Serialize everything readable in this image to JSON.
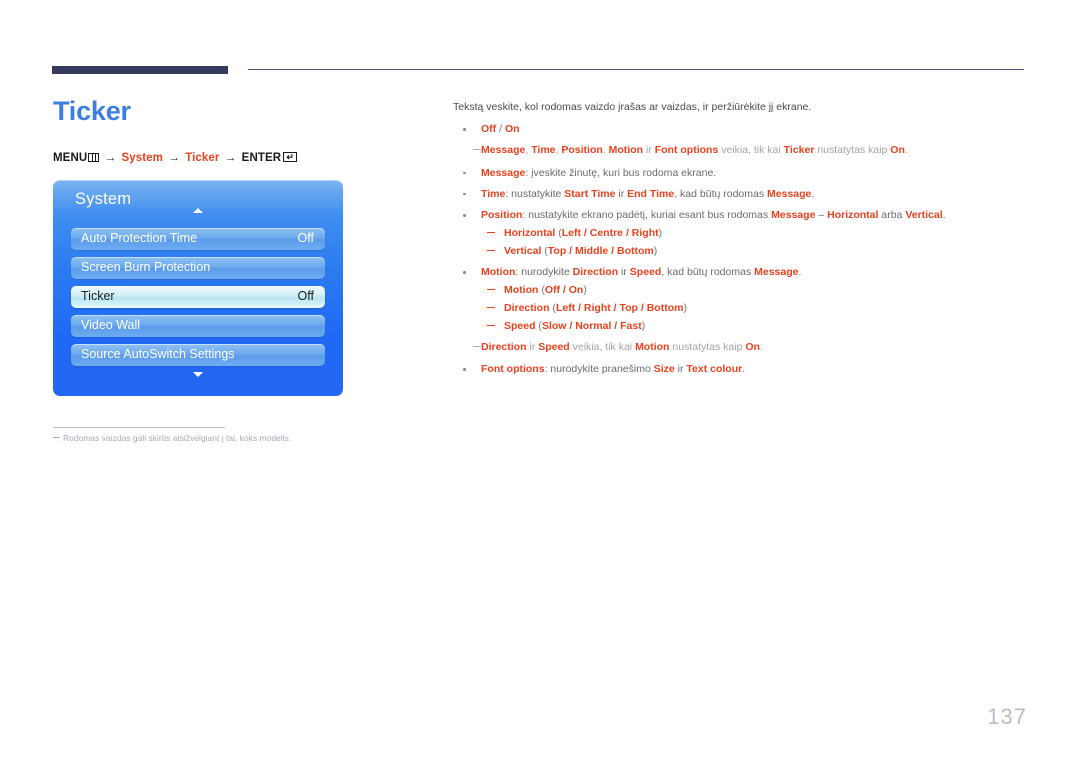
{
  "header": {
    "title": "Ticker",
    "breadcrumb": {
      "menu_label": "MENU",
      "menu_icon": "menu-bars-icon",
      "arrow": "→",
      "step1": "System",
      "step2": "Ticker",
      "enter_label": "ENTER",
      "enter_icon": "enter-key-icon",
      "enter_glyph": "↵"
    }
  },
  "osd": {
    "title": "System",
    "scroll_up_icon": "caret-up-icon",
    "scroll_down_icon": "caret-down-icon",
    "rows": [
      {
        "label": "Auto Protection Time",
        "value": "Off",
        "selected": false
      },
      {
        "label": "Screen Burn Protection",
        "value": "",
        "selected": false
      },
      {
        "label": "Ticker",
        "value": "Off",
        "selected": true
      },
      {
        "label": "Video Wall",
        "value": "",
        "selected": false
      },
      {
        "label": "Source AutoSwitch Settings",
        "value": "",
        "selected": false
      }
    ]
  },
  "footnote": {
    "text": "Rodomas vaizdas gali skirtis atsižvelgiant į tai, koks modelis."
  },
  "content": {
    "intro": "Tekstą veskite, kol rodomas vaizdo įrašas ar vaizdas, ir peržiūrėkite jį ekrane.",
    "b1": {
      "off": "Off",
      "slash": " / ",
      "on": "On"
    },
    "note1": {
      "t1": "Message",
      "c1": ", ",
      "t2": "Time",
      "c2": ", ",
      "t3": "Position",
      "c3": ", ",
      "t4": "Motion",
      "c4": " ir ",
      "t5": "Font options",
      "tail1": " veikia, tik kai ",
      "t6": "Ticker",
      "tail2": " nustatytas kaip ",
      "t7": "On",
      "tail3": "."
    },
    "b2": {
      "term": "Message",
      "rest": ": įveskite žinutę, kuri bus rodoma ekrane."
    },
    "b3": {
      "term": "Time",
      "p1": ": nustatykite ",
      "t1": "Start Time",
      "p2": " ir ",
      "t2": "End Time",
      "p3": ", kad būtų rodomas ",
      "t3": "Message",
      "p4": "."
    },
    "b4": {
      "term": "Position",
      "p1": ": nustatykite ekrano padėtį, kuriai esant bus rodomas ",
      "t1": "Message",
      "p2": " – ",
      "t2": "Horizontal",
      "p3": " arba ",
      "t3": "Vertical",
      "p4": "."
    },
    "b4_sub": [
      {
        "term": "Horizontal",
        "open": " (",
        "opts": "Left / Centre / Right",
        "close": ")"
      },
      {
        "term": "Vertical",
        "open": " (",
        "opts": "Top / Middle / Bottom",
        "close": ")"
      }
    ],
    "b5": {
      "term": "Motion",
      "p1": ": nurodykite ",
      "t1": "Direction",
      "p2": " ir ",
      "t2": "Speed",
      "p3": ", kad būtų rodomas ",
      "t3": "Message",
      "p4": "."
    },
    "b5_sub": [
      {
        "term": "Motion",
        "open": " (",
        "opts": "Off / On",
        "close": ")"
      },
      {
        "term": "Direction",
        "open": " (",
        "opts": "Left / Right / Top / Bottom",
        "close": ")"
      },
      {
        "term": "Speed",
        "open": " (",
        "opts": "Slow / Normal / Fast",
        "close": ")"
      }
    ],
    "note2": {
      "t1": "Direction",
      "c1": " ir ",
      "t2": "Speed",
      "tail1": " veikia, tik kai ",
      "t3": "Motion",
      "tail2": " nustatytas kaip ",
      "t4": "On",
      "tail3": "."
    },
    "b6": {
      "term": "Font options",
      "p1": ": nurodykite pranešimo ",
      "t1": "Size",
      "p2": " ir ",
      "t2": "Text colour",
      "p3": "."
    }
  },
  "page_number": "137"
}
